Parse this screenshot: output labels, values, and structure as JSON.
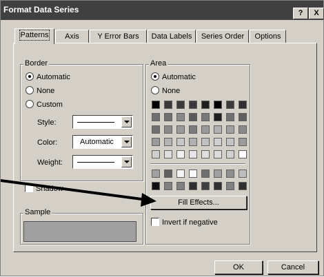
{
  "window": {
    "title": "Format Data Series",
    "help_label": "?",
    "close_label": "X"
  },
  "tabs": [
    {
      "label": "Patterns",
      "active": true
    },
    {
      "label": "Axis"
    },
    {
      "label": "Y Error Bars"
    },
    {
      "label": "Data Labels"
    },
    {
      "label": "Series Order"
    },
    {
      "label": "Options"
    }
  ],
  "border": {
    "title": "Border",
    "options": [
      "Automatic",
      "None",
      "Custom"
    ],
    "selected": "Automatic",
    "style_label": "Style:",
    "color_label": "Color:",
    "color_value": "Automatic",
    "weight_label": "Weight:",
    "shadow_label": "Shadow"
  },
  "sample": {
    "title": "Sample",
    "fill_color": "#a0a0a0"
  },
  "area": {
    "title": "Area",
    "options": [
      "Automatic",
      "None"
    ],
    "selected": "Automatic",
    "palette": [
      [
        "#000000",
        "#3a3a3a",
        "#3a3a3a",
        "#3a3a3a",
        "#202020",
        "#000000",
        "#3a3a3a",
        "#303030"
      ],
      [
        "#707070",
        "#707070",
        "#888888",
        "#5a5a5a",
        "#787878",
        "#1e1e1e",
        "#707070",
        "#606060"
      ],
      [
        "#707070",
        "#8a8a8a",
        "#9a9a9a",
        "#7a7a7a",
        "#9a9a9a",
        "#b0b0b0",
        "#a0a0a0",
        "#8a8a8a"
      ],
      [
        "#9a9a9a",
        "#b4b4b4",
        "#c8c8c8",
        "#b0b0b0",
        "#c0c0c0",
        "#d0d0d0",
        "#c4c4c4",
        "#9a9a9a"
      ],
      [
        "#cfcfcf",
        "#dedede",
        "#f0f0f0",
        "#e4e4e4",
        "#e0e0e0",
        "#dcdcdc",
        "#d0d0d0",
        "#ffffff"
      ]
    ],
    "palette2": [
      [
        "#a0a0a0",
        "#606060",
        "#f4f4f4",
        "#f8f8f8",
        "#707070",
        "#a0a0a0",
        "#909090",
        "#bcbcbc"
      ],
      [
        "#101010",
        "#808080",
        "#808080",
        "#303030",
        "#404040",
        "#303030",
        "#808080",
        "#303030"
      ]
    ],
    "fill_effects_label": "Fill Effects...",
    "invert_label": "Invert if negative"
  },
  "footer": {
    "ok_label": "OK",
    "cancel_label": "Cancel"
  }
}
